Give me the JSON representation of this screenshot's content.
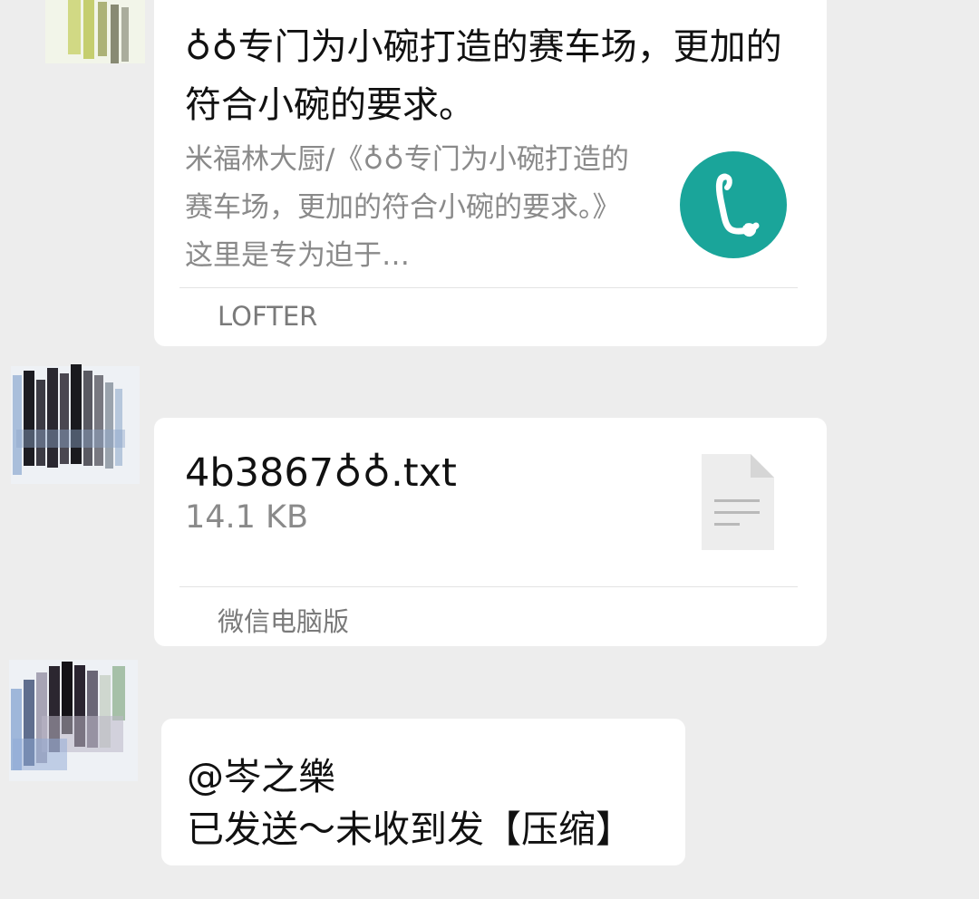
{
  "messages": {
    "link_card": {
      "title": "♁♁专门为小碗打造的赛车场，更加的符合小碗的要求。",
      "description": "米福林大厨/《♁♁专门为小碗打造的赛车场，更加的符合小碗的要求。》这里是专为迫于…",
      "source": "LOFTER",
      "logo_icon": "lofter-logo-icon",
      "logo_color": "#1aa59a"
    },
    "file_card": {
      "file_name": "4b3867♁♁.txt",
      "file_size": "14.1 KB",
      "source": "微信电脑版",
      "file_icon": "text-file-icon"
    },
    "text_message": {
      "line1": "@岑之樂",
      "line2": "已发送～未收到发【压缩】"
    }
  },
  "colors": {
    "background": "#ededed",
    "bubble": "#ffffff",
    "primary_text": "#111111",
    "secondary_text": "#8a8a8a"
  }
}
